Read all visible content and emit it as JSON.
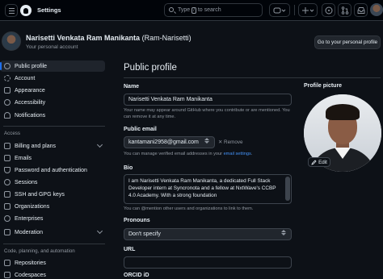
{
  "topbar": {
    "title": "Settings",
    "search": {
      "before": "Type",
      "key": "/",
      "after": "to search"
    },
    "icons": [
      "hamburger-icon",
      "github-logo",
      "search-icon",
      "copilot-icon",
      "plus-icon",
      "issues-icon",
      "pull-requests-icon",
      "inbox-icon",
      "user-avatar"
    ]
  },
  "header": {
    "name": "Narisetti Venkata Ram Manikanta",
    "handle": "(Ram-Narisetti)",
    "subtitle": "Your personal account",
    "goto_button": "Go to your personal profile"
  },
  "sidebar": {
    "items": [
      {
        "label": "Public profile",
        "icon": "person-icon",
        "active": true
      },
      {
        "label": "Account",
        "icon": "gear-icon"
      },
      {
        "label": "Appearance",
        "icon": "paintbrush-icon"
      },
      {
        "label": "Accessibility",
        "icon": "accessibility-icon"
      },
      {
        "label": "Notifications",
        "icon": "bell-icon"
      }
    ],
    "access_heading": "Access",
    "access_items": [
      {
        "label": "Billing and plans",
        "icon": "credit-card-icon",
        "expandable": true
      },
      {
        "label": "Emails",
        "icon": "mail-icon"
      },
      {
        "label": "Password and authentication",
        "icon": "shield-lock-icon"
      },
      {
        "label": "Sessions",
        "icon": "broadcast-icon"
      },
      {
        "label": "SSH and GPG keys",
        "icon": "key-icon"
      },
      {
        "label": "Organizations",
        "icon": "organization-icon"
      },
      {
        "label": "Enterprises",
        "icon": "globe-icon"
      },
      {
        "label": "Moderation",
        "icon": "report-icon",
        "expandable": true
      }
    ],
    "code_heading": "Code, planning, and automation",
    "code_items": [
      {
        "label": "Repositories",
        "icon": "repo-icon"
      },
      {
        "label": "Codespaces",
        "icon": "codespaces-icon"
      }
    ]
  },
  "main": {
    "title": "Public profile",
    "name": {
      "label": "Name",
      "value": "Narisetti Venkata Ram Manikanta",
      "hint": "Your name may appear around GitHub where you contribute or are mentioned. You can remove it at any time."
    },
    "email": {
      "label": "Public email",
      "value": "kantamani2958@gmail.com",
      "remove": "Remove",
      "hint_before": "You can manage verified email addresses in your",
      "hint_link": "email settings",
      "hint_after": "."
    },
    "bio": {
      "label": "Bio",
      "value": "I am Narisetti Venkata Ram Manikanta, a dedicated Full Stack Developer intern at Syncronota and a fellow at NxtWave's CCBP 4.0 Academy. With a strong foundation",
      "hint": "You can @mention other users and organizations to link to them."
    },
    "pronouns": {
      "label": "Pronouns",
      "value": "Don't specify"
    },
    "url": {
      "label": "URL",
      "value": ""
    },
    "orcid": {
      "label": "ORCID iD"
    }
  },
  "profile_picture": {
    "label": "Profile picture",
    "edit": "Edit"
  }
}
